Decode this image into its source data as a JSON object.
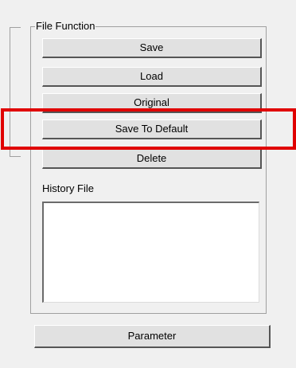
{
  "file_function": {
    "title": "File Function",
    "buttons": {
      "save": "Save",
      "load": "Load",
      "original": "Original",
      "save_to_default": "Save To Default",
      "delete": "Delete"
    },
    "history_label": "History File"
  },
  "parameter_button": "Parameter",
  "annotation": {
    "highlight_color": "#e00000"
  }
}
